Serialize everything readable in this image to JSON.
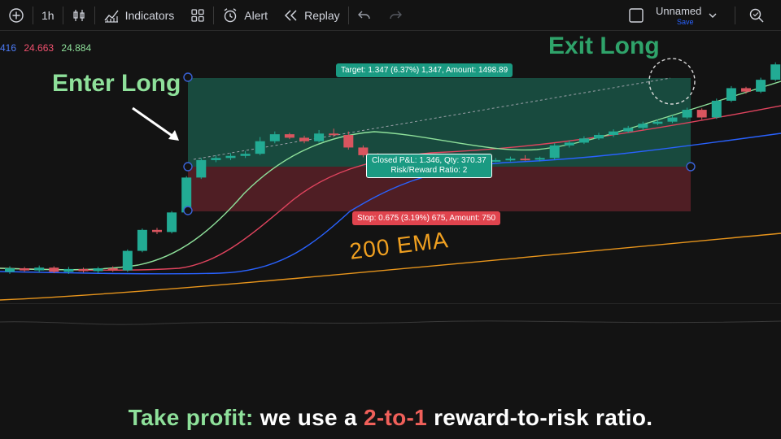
{
  "toolbar": {
    "interval": "1h",
    "indicators_label": "Indicators",
    "alert_label": "Alert",
    "replay_label": "Replay",
    "layout_name": "Unnamed",
    "layout_save": "Save"
  },
  "indicator_values": [
    {
      "text": "416",
      "color": "#4c7bf5"
    },
    {
      "text": "24.663",
      "color": "#f0506e"
    },
    {
      "text": "24.884",
      "color": "#8ee09a"
    }
  ],
  "annotations": {
    "enter": "Enter Long",
    "exit": "Exit Long",
    "ema": "200 EMA",
    "target": "Target: 1.347 (6.37%) 1,347, Amount: 1498.89",
    "closed_line1": "Closed P&L: 1.346, Qty: 370.37",
    "closed_line2": "Risk/Reward Ratio: 2",
    "stop": "Stop: 0.675 (3.19%) 675, Amount: 750"
  },
  "caption": {
    "part1": "Take profit:",
    "part2": " we use a ",
    "part3": "2-to-1",
    "part4": " reward-to-risk ratio."
  },
  "colors": {
    "up": "#22ab94",
    "down": "#d9555f",
    "ema_fast": "#8ee09a",
    "ema_mid": "#e0445e",
    "ema_slow": "#2962ff",
    "ema_200": "#e8951c"
  },
  "chart_data": {
    "type": "candlestick",
    "candles": [
      {
        "o": 295,
        "c": 300,
        "h": 303,
        "l": 292
      },
      {
        "o": 300,
        "c": 297,
        "h": 302,
        "l": 295
      },
      {
        "o": 297,
        "c": 301,
        "h": 304,
        "l": 294
      },
      {
        "o": 301,
        "c": 295,
        "h": 303,
        "l": 293
      },
      {
        "o": 295,
        "c": 299,
        "h": 302,
        "l": 292
      },
      {
        "o": 299,
        "c": 296,
        "h": 301,
        "l": 294
      },
      {
        "o": 296,
        "c": 300,
        "h": 302,
        "l": 293
      },
      {
        "o": 300,
        "c": 297,
        "h": 303,
        "l": 295
      },
      {
        "o": 297,
        "c": 325,
        "h": 327,
        "l": 295
      },
      {
        "o": 325,
        "c": 355,
        "h": 357,
        "l": 323
      },
      {
        "o": 355,
        "c": 352,
        "h": 358,
        "l": 349
      },
      {
        "o": 352,
        "c": 380,
        "h": 382,
        "l": 350
      },
      {
        "o": 380,
        "c": 430,
        "h": 432,
        "l": 378
      },
      {
        "o": 430,
        "c": 455,
        "h": 458,
        "l": 428
      },
      {
        "o": 455,
        "c": 458,
        "h": 462,
        "l": 452
      },
      {
        "o": 458,
        "c": 461,
        "h": 465,
        "l": 455
      },
      {
        "o": 461,
        "c": 464,
        "h": 468,
        "l": 458
      },
      {
        "o": 464,
        "c": 482,
        "h": 488,
        "l": 462
      },
      {
        "o": 482,
        "c": 492,
        "h": 496,
        "l": 479
      },
      {
        "o": 492,
        "c": 487,
        "h": 494,
        "l": 485
      },
      {
        "o": 487,
        "c": 482,
        "h": 490,
        "l": 479
      },
      {
        "o": 482,
        "c": 493,
        "h": 498,
        "l": 480
      },
      {
        "o": 493,
        "c": 491,
        "h": 500,
        "l": 488
      },
      {
        "o": 491,
        "c": 473,
        "h": 496,
        "l": 470
      },
      {
        "o": 473,
        "c": 462,
        "h": 476,
        "l": 459
      },
      {
        "o": 462,
        "c": 456,
        "h": 465,
        "l": 453
      },
      {
        "o": 456,
        "c": 452,
        "h": 459,
        "l": 450
      },
      {
        "o": 452,
        "c": 454,
        "h": 458,
        "l": 450
      },
      {
        "o": 454,
        "c": 452,
        "h": 457,
        "l": 450
      },
      {
        "o": 452,
        "c": 455,
        "h": 458,
        "l": 450
      },
      {
        "o": 455,
        "c": 458,
        "h": 462,
        "l": 452
      },
      {
        "o": 458,
        "c": 451,
        "h": 460,
        "l": 448
      },
      {
        "o": 451,
        "c": 454,
        "h": 457,
        "l": 449
      },
      {
        "o": 454,
        "c": 455,
        "h": 458,
        "l": 452
      },
      {
        "o": 455,
        "c": 457,
        "h": 460,
        "l": 453
      },
      {
        "o": 457,
        "c": 456,
        "h": 462,
        "l": 454
      },
      {
        "o": 456,
        "c": 458,
        "h": 460,
        "l": 453
      },
      {
        "o": 458,
        "c": 476,
        "h": 479,
        "l": 456
      },
      {
        "o": 476,
        "c": 480,
        "h": 483,
        "l": 473
      },
      {
        "o": 480,
        "c": 486,
        "h": 489,
        "l": 478
      },
      {
        "o": 486,
        "c": 491,
        "h": 494,
        "l": 484
      },
      {
        "o": 491,
        "c": 496,
        "h": 499,
        "l": 488
      },
      {
        "o": 496,
        "c": 501,
        "h": 504,
        "l": 494
      },
      {
        "o": 501,
        "c": 507,
        "h": 510,
        "l": 498
      },
      {
        "o": 507,
        "c": 510,
        "h": 513,
        "l": 505
      },
      {
        "o": 510,
        "c": 516,
        "h": 519,
        "l": 508
      },
      {
        "o": 516,
        "c": 527,
        "h": 530,
        "l": 514
      },
      {
        "o": 527,
        "c": 516,
        "h": 529,
        "l": 513
      },
      {
        "o": 516,
        "c": 540,
        "h": 543,
        "l": 514
      },
      {
        "o": 540,
        "c": 558,
        "h": 561,
        "l": 538
      },
      {
        "o": 558,
        "c": 553,
        "h": 560,
        "l": 550
      },
      {
        "o": 553,
        "c": 570,
        "h": 573,
        "l": 551
      },
      {
        "o": 570,
        "c": 592,
        "h": 595,
        "l": 568
      },
      {
        "o": 592,
        "c": 600,
        "h": 603,
        "l": 590
      },
      {
        "o": 600,
        "c": 608,
        "h": 611,
        "l": 598
      },
      {
        "o": 608,
        "c": 615,
        "h": 618,
        "l": 606
      }
    ],
    "entry_index": 12,
    "exit_index": 47,
    "target_price": 548,
    "entry_price": 430,
    "stop_price": 372
  }
}
